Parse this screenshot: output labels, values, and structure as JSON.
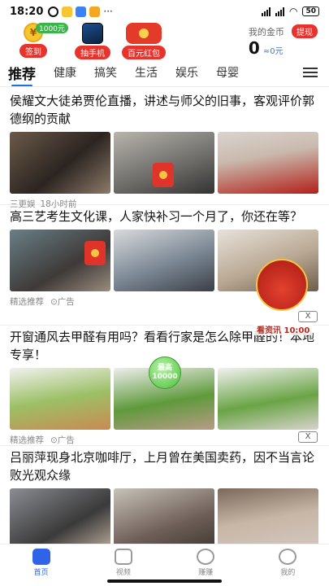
{
  "status_bar": {
    "time": "18:20",
    "signal": "4G",
    "battery": "50"
  },
  "reward_bar": {
    "checkin_badge": "1000元",
    "checkin_label": "签到",
    "phone_label": "抽手机",
    "redpacket_label": "百元红包",
    "gold_label": "我的金币",
    "withdraw_label": "提现",
    "gold_count": "0",
    "gold_yuan": "≈0元"
  },
  "tabs": [
    "推荐",
    "健康",
    "搞笑",
    "生活",
    "娱乐",
    "母婴"
  ],
  "articles": [
    {
      "title": "侯耀文大徒弟贾伦直播，讲述与师父的旧事，客观评价郭德纲的贡献",
      "source": "三更娱",
      "time": "18小时前",
      "ad": ""
    },
    {
      "title": "高三艺考生文化课，人家快补习一个月了，你还在等？",
      "source": "精选推荐",
      "time": "",
      "ad": "广告"
    },
    {
      "title": "开窗通风去甲醛有用吗？看看行家是怎么除甲醛的！本地专享！",
      "source": "精选推荐",
      "time": "",
      "ad": "广告"
    },
    {
      "title": "吕丽萍现身北京咖啡厅，上月曾在美国卖药，因不当言论败光观众缘",
      "source": "",
      "time": "",
      "ad": ""
    }
  ],
  "floating": {
    "bubble_line1": "最高",
    "bubble_line2": "10000",
    "bag_label": "看资讯 10:00",
    "close": "X"
  },
  "bottom_nav": [
    "首页",
    "视频",
    "赚赚",
    "我的"
  ]
}
